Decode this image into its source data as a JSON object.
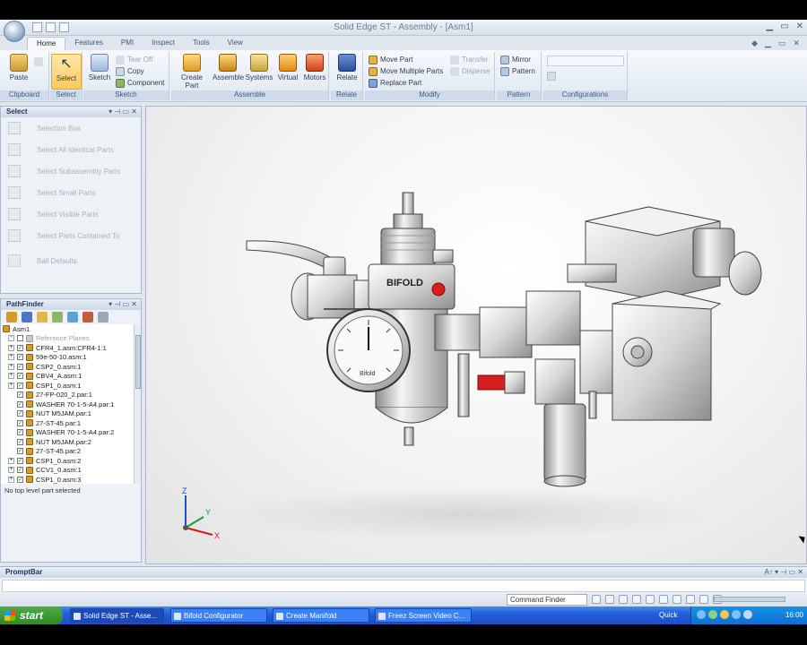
{
  "window": {
    "title": "Solid Edge ST - Assembly - [Asm1]"
  },
  "ribbon_tabs": [
    "Home",
    "Features",
    "PMI",
    "Inspect",
    "Tools",
    "View"
  ],
  "ribbon": {
    "clipboard": {
      "label": "Clipboard",
      "paste": "Paste"
    },
    "select": {
      "label": "Select",
      "select": "Select"
    },
    "sketch": {
      "label": "Sketch",
      "sketch": "Sketch",
      "tear_off": "Tear Off",
      "copy": "Copy",
      "component": "Component"
    },
    "assemble": {
      "label": "Assemble",
      "create_part": "Create Part\nIn-Place",
      "assemble": "Assemble",
      "systems": "Systems",
      "virtual": "Virtual",
      "motors": "Motors"
    },
    "relate": {
      "label": "Relate",
      "relate": "Relate"
    },
    "modify": {
      "label": "Modify",
      "move_part": "Move Part",
      "move_multiple": "Move Multiple Parts",
      "replace_part": "Replace Part",
      "transfer": "Transfer",
      "disperse": "Disperse"
    },
    "pattern": {
      "label": "Pattern",
      "mirror": "Mirror",
      "pattern": "Pattern"
    },
    "configurations": {
      "label": "Configurations"
    }
  },
  "select_panel": {
    "title": "Select",
    "items": [
      "Selection Box",
      "Select All Identical Parts",
      "Select Subassembly Parts",
      "Select Small Parts",
      "Select Visible Parts",
      "Select Parts Contained To",
      "Ball Defaults"
    ]
  },
  "pathfinder": {
    "title": "PathFinder",
    "root": "Asm1",
    "items": [
      {
        "label": "Reference Planes",
        "ref": true
      },
      {
        "label": "CFR4_1.asm:CFR4-1:1",
        "ref": false
      },
      {
        "label": "59e-50-10.asm:1",
        "ref": false
      },
      {
        "label": "CSP2_0.asm:1",
        "ref": false
      },
      {
        "label": "CBV4_A.asm:1",
        "ref": false
      },
      {
        "label": "CSP1_0.asm:1",
        "ref": false
      },
      {
        "label": "27-FP-020_2.par:1",
        "ref": false
      },
      {
        "label": "WASHER 70-1-5-A4.par:1",
        "ref": false
      },
      {
        "label": "NUT M5JAM.par:1",
        "ref": false
      },
      {
        "label": "27-ST-45.par:1",
        "ref": false
      },
      {
        "label": "WASHER 70-1-5-A4.par:2",
        "ref": false
      },
      {
        "label": "NUT M5JAM.par:2",
        "ref": false
      },
      {
        "label": "27-ST-45.par:2",
        "ref": false
      },
      {
        "label": "CSP1_0.asm:2",
        "ref": false
      },
      {
        "label": "CCV1_0.asm:1",
        "ref": false
      },
      {
        "label": "CSP1_0.asm:3",
        "ref": false
      }
    ],
    "status": "No top level part selected"
  },
  "viewport": {
    "gauge_brand": "BIFOLD",
    "gauge_brand_small": "Bifold",
    "axis_x": "X",
    "axis_y": "Y",
    "axis_z": "Z"
  },
  "promptbar": {
    "title": "PromptBar",
    "command_finder": "Command Finder"
  },
  "taskbar": {
    "start": "start",
    "tasks": [
      "Solid Edge ST - Asse...",
      "Bifold Configurator",
      "Create Manifold",
      "Freez Screen Video C..."
    ],
    "quick": "Quick",
    "time": "16:00"
  }
}
